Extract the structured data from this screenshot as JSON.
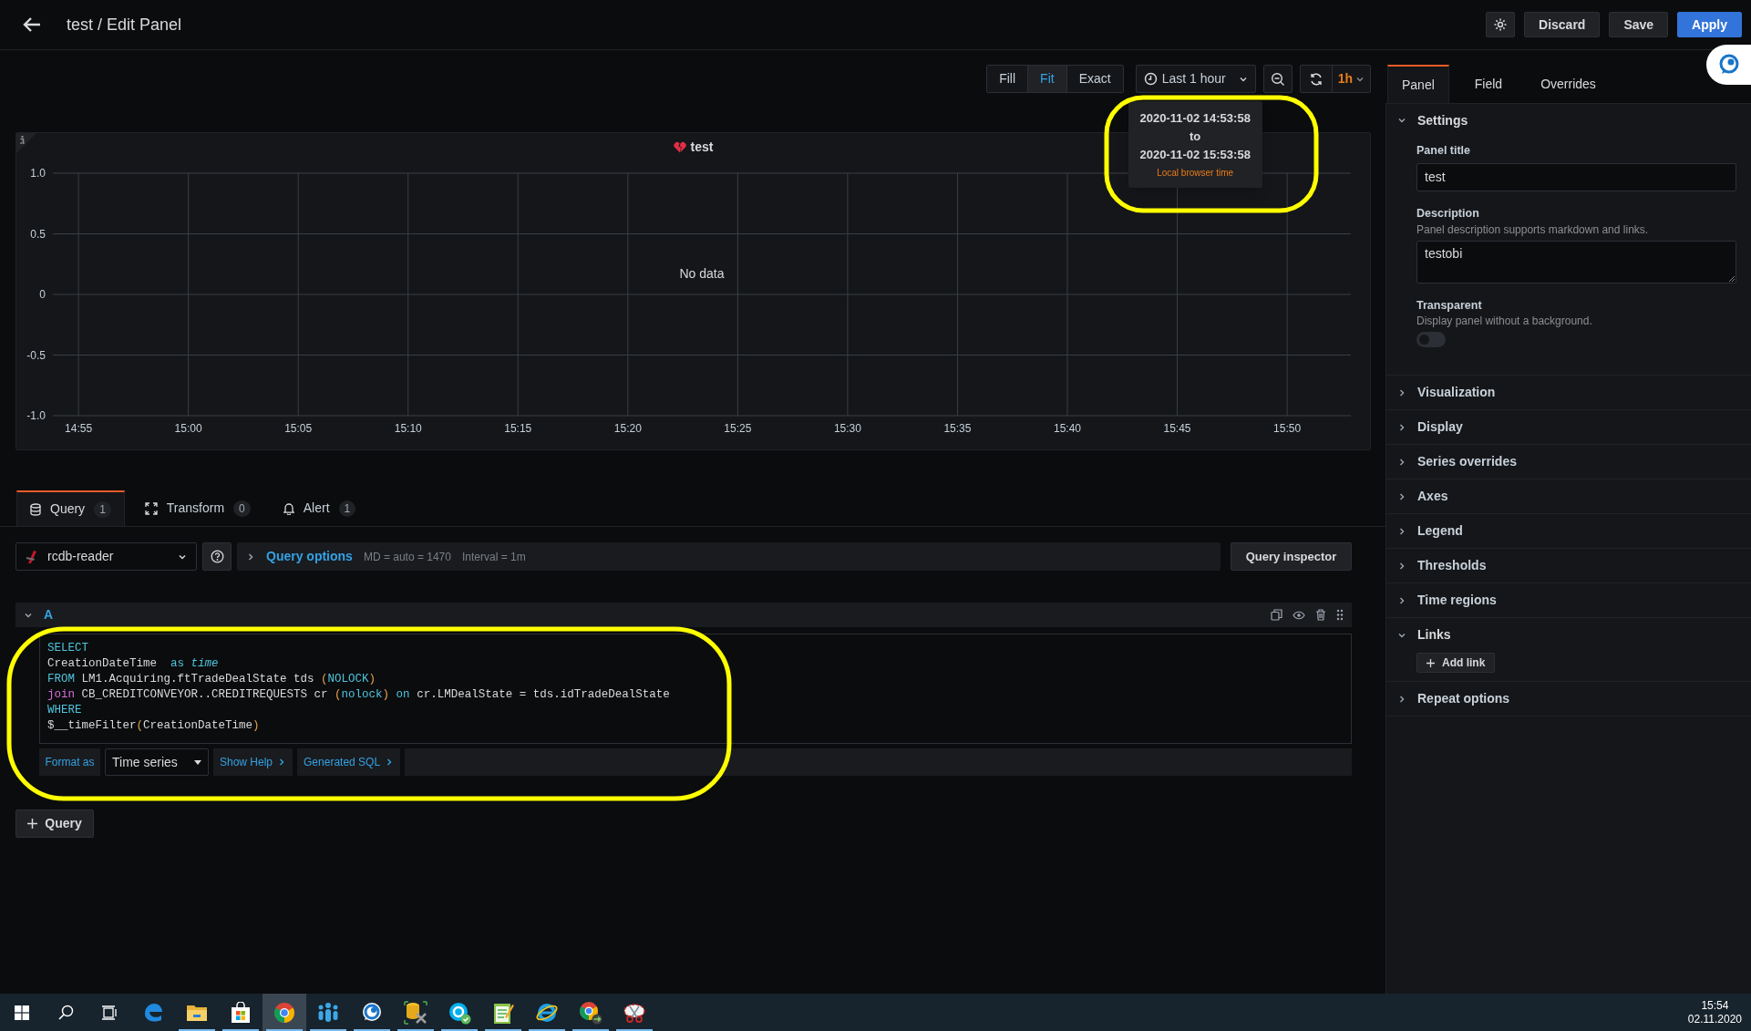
{
  "header": {
    "title": "test / Edit Panel",
    "buttons": [
      {
        "label": "Discard",
        "kind": "secondary"
      },
      {
        "label": "Save",
        "kind": "secondary"
      },
      {
        "label": "Apply",
        "kind": "primary"
      }
    ]
  },
  "toolbar": {
    "display_modes": [
      {
        "label": "Fill",
        "selected": false
      },
      {
        "label": "Fit",
        "selected": true
      },
      {
        "label": "Exact",
        "selected": false
      }
    ],
    "time_range": "Last 1 hour",
    "refresh_interval": "1h"
  },
  "time_tooltip": {
    "from": "2020-11-02 14:53:58",
    "separator": "to",
    "to": "2020-11-02 15:53:58",
    "zone": "Local browser time",
    "highlighted": true
  },
  "panel": {
    "title": "test",
    "error": true,
    "message": "No data",
    "chart_data": {
      "type": "line",
      "grid": true,
      "ylim": [
        -1,
        1
      ],
      "categories": [
        "14:55",
        "15:00",
        "15:05",
        "15:10",
        "15:15",
        "15:20",
        "15:25",
        "15:30",
        "15:35",
        "15:40",
        "15:45",
        "15:50"
      ],
      "yticks": [
        {
          "value": 1,
          "label": "1.0"
        },
        {
          "value": 0.5,
          "label": "0.5"
        },
        0,
        {
          "value": -0.5,
          "label": "-0.5"
        },
        {
          "value": -1,
          "label": "-1.0"
        }
      ]
    }
  },
  "query_tabs": [
    {
      "kind": "query",
      "label": "Query",
      "count": "1",
      "selected": true
    },
    {
      "kind": "transform",
      "label": "Transform",
      "count": "0",
      "selected": false
    },
    {
      "kind": "alert",
      "label": "Alert",
      "count": "1",
      "selected": false
    }
  ],
  "datasource": {
    "name": "rcdb-reader",
    "options_label": "Query options",
    "max_data_points": "MD = auto = 1470",
    "interval": "Interval = 1m",
    "inspector_button": "Query inspector"
  },
  "query": {
    "ref": "A",
    "expanded": true,
    "highlighted": true,
    "lines": [
      [
        {
          "text": "SELECT",
          "kind": "keyword"
        }
      ],
      [
        {
          "text": "CreationDateTime  ",
          "kind": "plain"
        },
        {
          "text": "as ",
          "kind": "keyword"
        },
        {
          "text": "time",
          "kind": "keyword_italic"
        }
      ],
      [
        {
          "text": "FROM",
          "kind": "keyword"
        },
        {
          "text": " LM1.Acquiring.ftTradeDealState tds ",
          "kind": "plain"
        },
        {
          "text": "(",
          "kind": "paren"
        },
        {
          "text": "NOLOCK",
          "kind": "keyword"
        },
        {
          "text": ")",
          "kind": "paren"
        }
      ],
      [
        {
          "text": "join",
          "kind": "function"
        },
        {
          "text": " CB_CREDITCONVEYOR..CREDITREQUESTS cr ",
          "kind": "plain"
        },
        {
          "text": "(",
          "kind": "paren"
        },
        {
          "text": "nolock",
          "kind": "keyword"
        },
        {
          "text": ") ",
          "kind": "paren"
        },
        {
          "text": "on",
          "kind": "keyword"
        },
        {
          "text": " cr.LMDealState = tds.idTradeDealState",
          "kind": "plain"
        }
      ],
      [
        {
          "text": "WHERE",
          "kind": "keyword"
        }
      ],
      [
        {
          "text": "$__timeFilter",
          "kind": "plain"
        },
        {
          "text": "(",
          "kind": "paren"
        },
        {
          "text": "CreationDateTime",
          "kind": "plain"
        },
        {
          "text": ")",
          "kind": "paren"
        }
      ]
    ],
    "format_label": "Format as",
    "format_value": "Time series",
    "links": [
      "Show Help",
      "Generated SQL"
    ]
  },
  "add_query_button": "Query",
  "options_pane": {
    "tabs": [
      {
        "label": "Panel",
        "selected": true
      },
      {
        "label": "Field",
        "selected": false
      },
      {
        "label": "Overrides",
        "selected": false
      }
    ],
    "settings": {
      "title": "Settings",
      "expanded": true,
      "fields": [
        {
          "kind": "input",
          "label": "Panel title",
          "value": "test"
        },
        {
          "kind": "textarea",
          "label": "Description",
          "hint": "Panel description supports markdown and links.",
          "value": "testobi"
        },
        {
          "kind": "toggle",
          "label": "Transparent",
          "hint": "Display panel without a background.",
          "on": false
        }
      ]
    },
    "sections": [
      {
        "title": "Visualization",
        "expanded": false
      },
      {
        "title": "Display",
        "expanded": false
      },
      {
        "title": "Series overrides",
        "expanded": false
      },
      {
        "title": "Axes",
        "expanded": false
      },
      {
        "title": "Legend",
        "expanded": false
      },
      {
        "title": "Thresholds",
        "expanded": false
      },
      {
        "title": "Time regions",
        "expanded": false
      },
      {
        "title": "Links",
        "expanded": true,
        "button": "Add link"
      },
      {
        "title": "Repeat options",
        "expanded": false
      }
    ]
  },
  "taskbar": {
    "apps": [
      {
        "kind": "edge",
        "running": false,
        "selected": false
      },
      {
        "kind": "explorer",
        "running": true,
        "selected": false
      },
      {
        "kind": "store",
        "running": true,
        "selected": false
      },
      {
        "kind": "chrome",
        "running": true,
        "selected": true
      },
      {
        "kind": "network",
        "running": true,
        "selected": false
      },
      {
        "kind": "chat",
        "running": true,
        "selected": false
      },
      {
        "kind": "dbtools",
        "running": true,
        "selected": false
      },
      {
        "kind": "skype",
        "running": true,
        "selected": false
      },
      {
        "kind": "notepad",
        "running": true,
        "selected": false
      },
      {
        "kind": "ie",
        "running": true,
        "selected": false
      },
      {
        "kind": "remote",
        "running": true,
        "selected": false
      },
      {
        "kind": "snip",
        "running": true,
        "selected": false
      }
    ],
    "clock": {
      "time": "15:54",
      "date": "02.11.2020"
    }
  }
}
